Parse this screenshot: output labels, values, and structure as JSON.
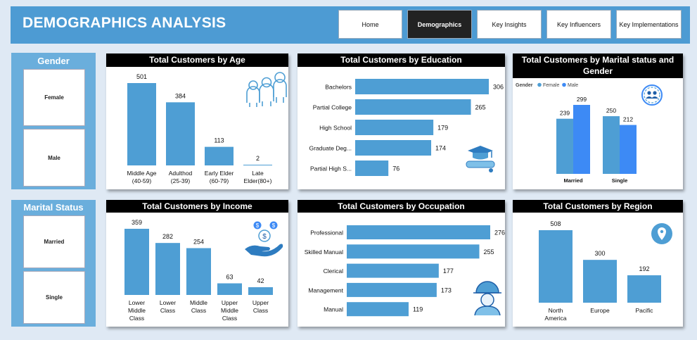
{
  "header": {
    "title": "DEMOGRAPHICS ANALYSIS",
    "nav": [
      "Home",
      "Demographics",
      "Key Insights",
      "Key Influencers",
      "Key Implementations"
    ],
    "active": "Demographics"
  },
  "slicers": {
    "gender": {
      "title": "Gender",
      "options": [
        "Female",
        "Male"
      ]
    },
    "marital": {
      "title": "Marital Status",
      "options": [
        "Married",
        "Single"
      ]
    }
  },
  "colors": {
    "bar": "#4e9ed4",
    "male": "#3d8af5",
    "header": "#4d9bd3",
    "slicer": "#6aaedc",
    "background": "#dfe9f4"
  },
  "icons": {
    "age": "people-group-icon",
    "education": "graduation-cap-icon",
    "marital": "couple-icon",
    "income": "money-hand-icon",
    "occupation": "worker-icon",
    "region": "location-pin-icon"
  },
  "chart_data": [
    {
      "id": "age",
      "type": "bar",
      "title": "Total Customers by Age",
      "categories": [
        "Middle Age (40-59)",
        "Adulthod (25-39)",
        "Early Elder (60-79)",
        "Late Elder(80+)"
      ],
      "labels": [
        [
          "Middle Age",
          "(40-59)"
        ],
        [
          "Adulthod",
          "(25-39)"
        ],
        [
          "Early Elder",
          "(60-79)"
        ],
        [
          "Late",
          "Elder(80+)"
        ]
      ],
      "values": [
        501,
        384,
        113,
        2
      ]
    },
    {
      "id": "education",
      "type": "bar",
      "orientation": "horizontal",
      "title": "Total Customers by Education",
      "categories": [
        "Bachelors",
        "Partial College",
        "High School",
        "Graduate Deg...",
        "Partial High S..."
      ],
      "values": [
        306,
        265,
        179,
        174,
        76
      ]
    },
    {
      "id": "marital",
      "type": "bar",
      "title": "Total Customers by Marital status and Gender",
      "legend_title": "Gender",
      "legend": "top-left",
      "categories": [
        "Married",
        "Single"
      ],
      "series": [
        {
          "name": "Female",
          "values": [
            239,
            250
          ]
        },
        {
          "name": "Male",
          "values": [
            299,
            212
          ]
        }
      ]
    },
    {
      "id": "income",
      "type": "bar",
      "title": "Total Customers by Income",
      "categories": [
        "Lower Middle Class",
        "Lower Class",
        "Middle Class",
        "Upper Middle Class",
        "Upper Class"
      ],
      "labels": [
        [
          "Lower",
          "Middle",
          "Class"
        ],
        [
          "Lower",
          "Class"
        ],
        [
          "Middle",
          "Class"
        ],
        [
          "Upper",
          "Middle",
          "Class"
        ],
        [
          "Upper",
          "Class"
        ]
      ],
      "values": [
        359,
        282,
        254,
        63,
        42
      ]
    },
    {
      "id": "occupation",
      "type": "bar",
      "orientation": "horizontal",
      "title": "Total Customers by Occupation",
      "categories": [
        "Professional",
        "Skilled Manual",
        "Clerical",
        "Management",
        "Manual"
      ],
      "values": [
        276,
        255,
        177,
        173,
        119
      ]
    },
    {
      "id": "region",
      "type": "bar",
      "title": "Total Customers by Region",
      "categories": [
        "North America",
        "Europe",
        "Pacific"
      ],
      "labels": [
        [
          "North",
          "America"
        ],
        [
          "Europe"
        ],
        [
          "Pacific"
        ]
      ],
      "values": [
        508,
        300,
        192
      ]
    }
  ]
}
